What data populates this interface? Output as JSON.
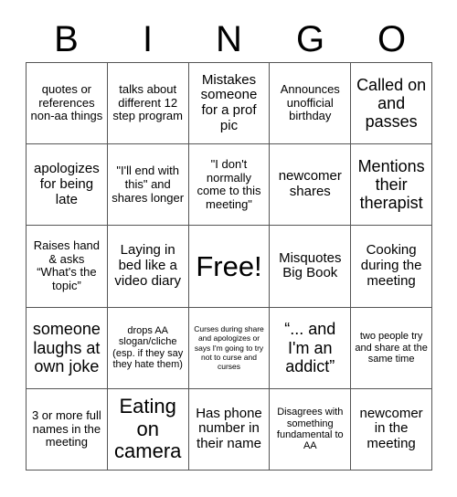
{
  "card": {
    "title_letters": [
      "B",
      "I",
      "N",
      "G",
      "O"
    ],
    "free_space_index": 12,
    "grid_line_color": "#555555",
    "background_color": "#ffffff",
    "text_color": "#000000",
    "columns": 5,
    "rows": 5
  },
  "cells": [
    {
      "text": "quotes or references non-aa things",
      "size": "fs-md"
    },
    {
      "text": "talks about different 12 step program",
      "size": "fs-md"
    },
    {
      "text": "Mistakes someone for a prof pic",
      "size": "fs-lg"
    },
    {
      "text": "Announces unofficial birthday",
      "size": "fs-md"
    },
    {
      "text": "Called on and passes",
      "size": "fs-xl"
    },
    {
      "text": "apologizes for being late",
      "size": "fs-lg"
    },
    {
      "text": "\"I'll end with this\" and shares longer",
      "size": "fs-md"
    },
    {
      "text": "\"I don't normally come to this meeting\"",
      "size": "fs-md"
    },
    {
      "text": "newcomer shares",
      "size": "fs-lg"
    },
    {
      "text": "Mentions their therapist",
      "size": "fs-xl"
    },
    {
      "text": "Raises hand & asks “What's the topic”",
      "size": "fs-md"
    },
    {
      "text": "Laying in bed like a video diary",
      "size": "fs-lg"
    },
    {
      "text": "Free!",
      "size": "fs-free"
    },
    {
      "text": "Misquotes Big Book",
      "size": "fs-lg"
    },
    {
      "text": "Cooking during the meeting",
      "size": "fs-lg"
    },
    {
      "text": "someone laughs at own joke",
      "size": "fs-xl"
    },
    {
      "text": "drops AA slogan/cliche (esp. if they say they hate them)",
      "size": "fs-sm"
    },
    {
      "text": "Curses during share and apologizes or says I'm going to try not to curse and curses",
      "size": "fs-xs"
    },
    {
      "text": "“... and I'm an addict”",
      "size": "fs-xl"
    },
    {
      "text": "two people try and share at the same time",
      "size": "fs-sm"
    },
    {
      "text": "3 or more full names in the meeting",
      "size": "fs-md"
    },
    {
      "text": "Eating on camera",
      "size": "fs-xxl"
    },
    {
      "text": "Has phone number in their name",
      "size": "fs-lg"
    },
    {
      "text": "Disagrees with something fundamental to AA",
      "size": "fs-sm"
    },
    {
      "text": "newcomer in the meeting",
      "size": "fs-lg"
    }
  ]
}
